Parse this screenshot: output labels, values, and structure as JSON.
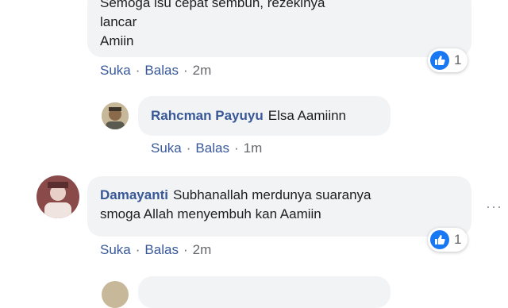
{
  "comment1": {
    "text_lines": [
      "Semoga isu cepat sembuh, rezekinya",
      "lancar",
      "Amiin"
    ],
    "reaction_count": "1",
    "actions": {
      "like": "Suka",
      "reply": "Balas",
      "time": "2m"
    }
  },
  "reply1": {
    "author": "Rahcman Payuyu",
    "text": "Elsa Aamiinn",
    "actions": {
      "like": "Suka",
      "reply": "Balas",
      "time": "1m"
    }
  },
  "comment2": {
    "author": "Damayanti",
    "text_line1": "Subhanallah merdunya suaranya",
    "text_line2": "smoga Allah menyembuh kan Aamiin",
    "reaction_count": "1",
    "actions": {
      "like": "Suka",
      "reply": "Balas",
      "time": "2m"
    },
    "more": "···"
  },
  "colors": {
    "link": "#385898",
    "bubble": "#f2f3f5",
    "like": "#1877f2",
    "meta": "#65676b"
  }
}
